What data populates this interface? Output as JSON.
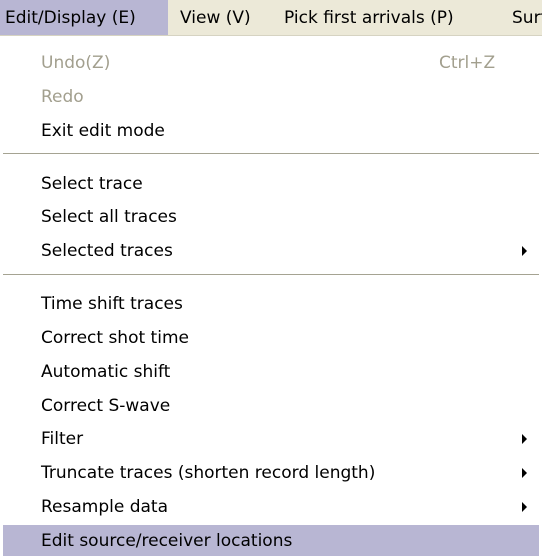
{
  "menubar": {
    "items": [
      {
        "label": "Edit/Display (E)"
      },
      {
        "label": "View (V)"
      },
      {
        "label": "Pick first arrivals (P)"
      },
      {
        "label": "Surf..."
      }
    ]
  },
  "menu": {
    "undo": {
      "label": "Undo(Z)",
      "shortcut": "Ctrl+Z"
    },
    "redo": {
      "label": "Redo"
    },
    "exit_edit_mode": {
      "label": "Exit edit mode"
    },
    "select_trace": {
      "label": "Select trace"
    },
    "select_all_traces": {
      "label": "Select all traces"
    },
    "selected_traces": {
      "label": "Selected traces"
    },
    "time_shift_traces": {
      "label": "Time shift traces"
    },
    "correct_shot_time": {
      "label": "Correct shot time"
    },
    "automatic_shift": {
      "label": "Automatic shift"
    },
    "correct_s_wave": {
      "label": "Correct S-wave"
    },
    "filter": {
      "label": "Filter"
    },
    "truncate_traces": {
      "label": "Truncate traces (shorten record length)"
    },
    "resample_data": {
      "label": "Resample data"
    },
    "edit_locations": {
      "label": "Edit source/receiver locations"
    }
  },
  "colors": {
    "menubar_bg": "#ece9d8",
    "highlight": "#b8b6d3",
    "disabled_text": "#a29f8e",
    "separator": "#a5a392"
  }
}
